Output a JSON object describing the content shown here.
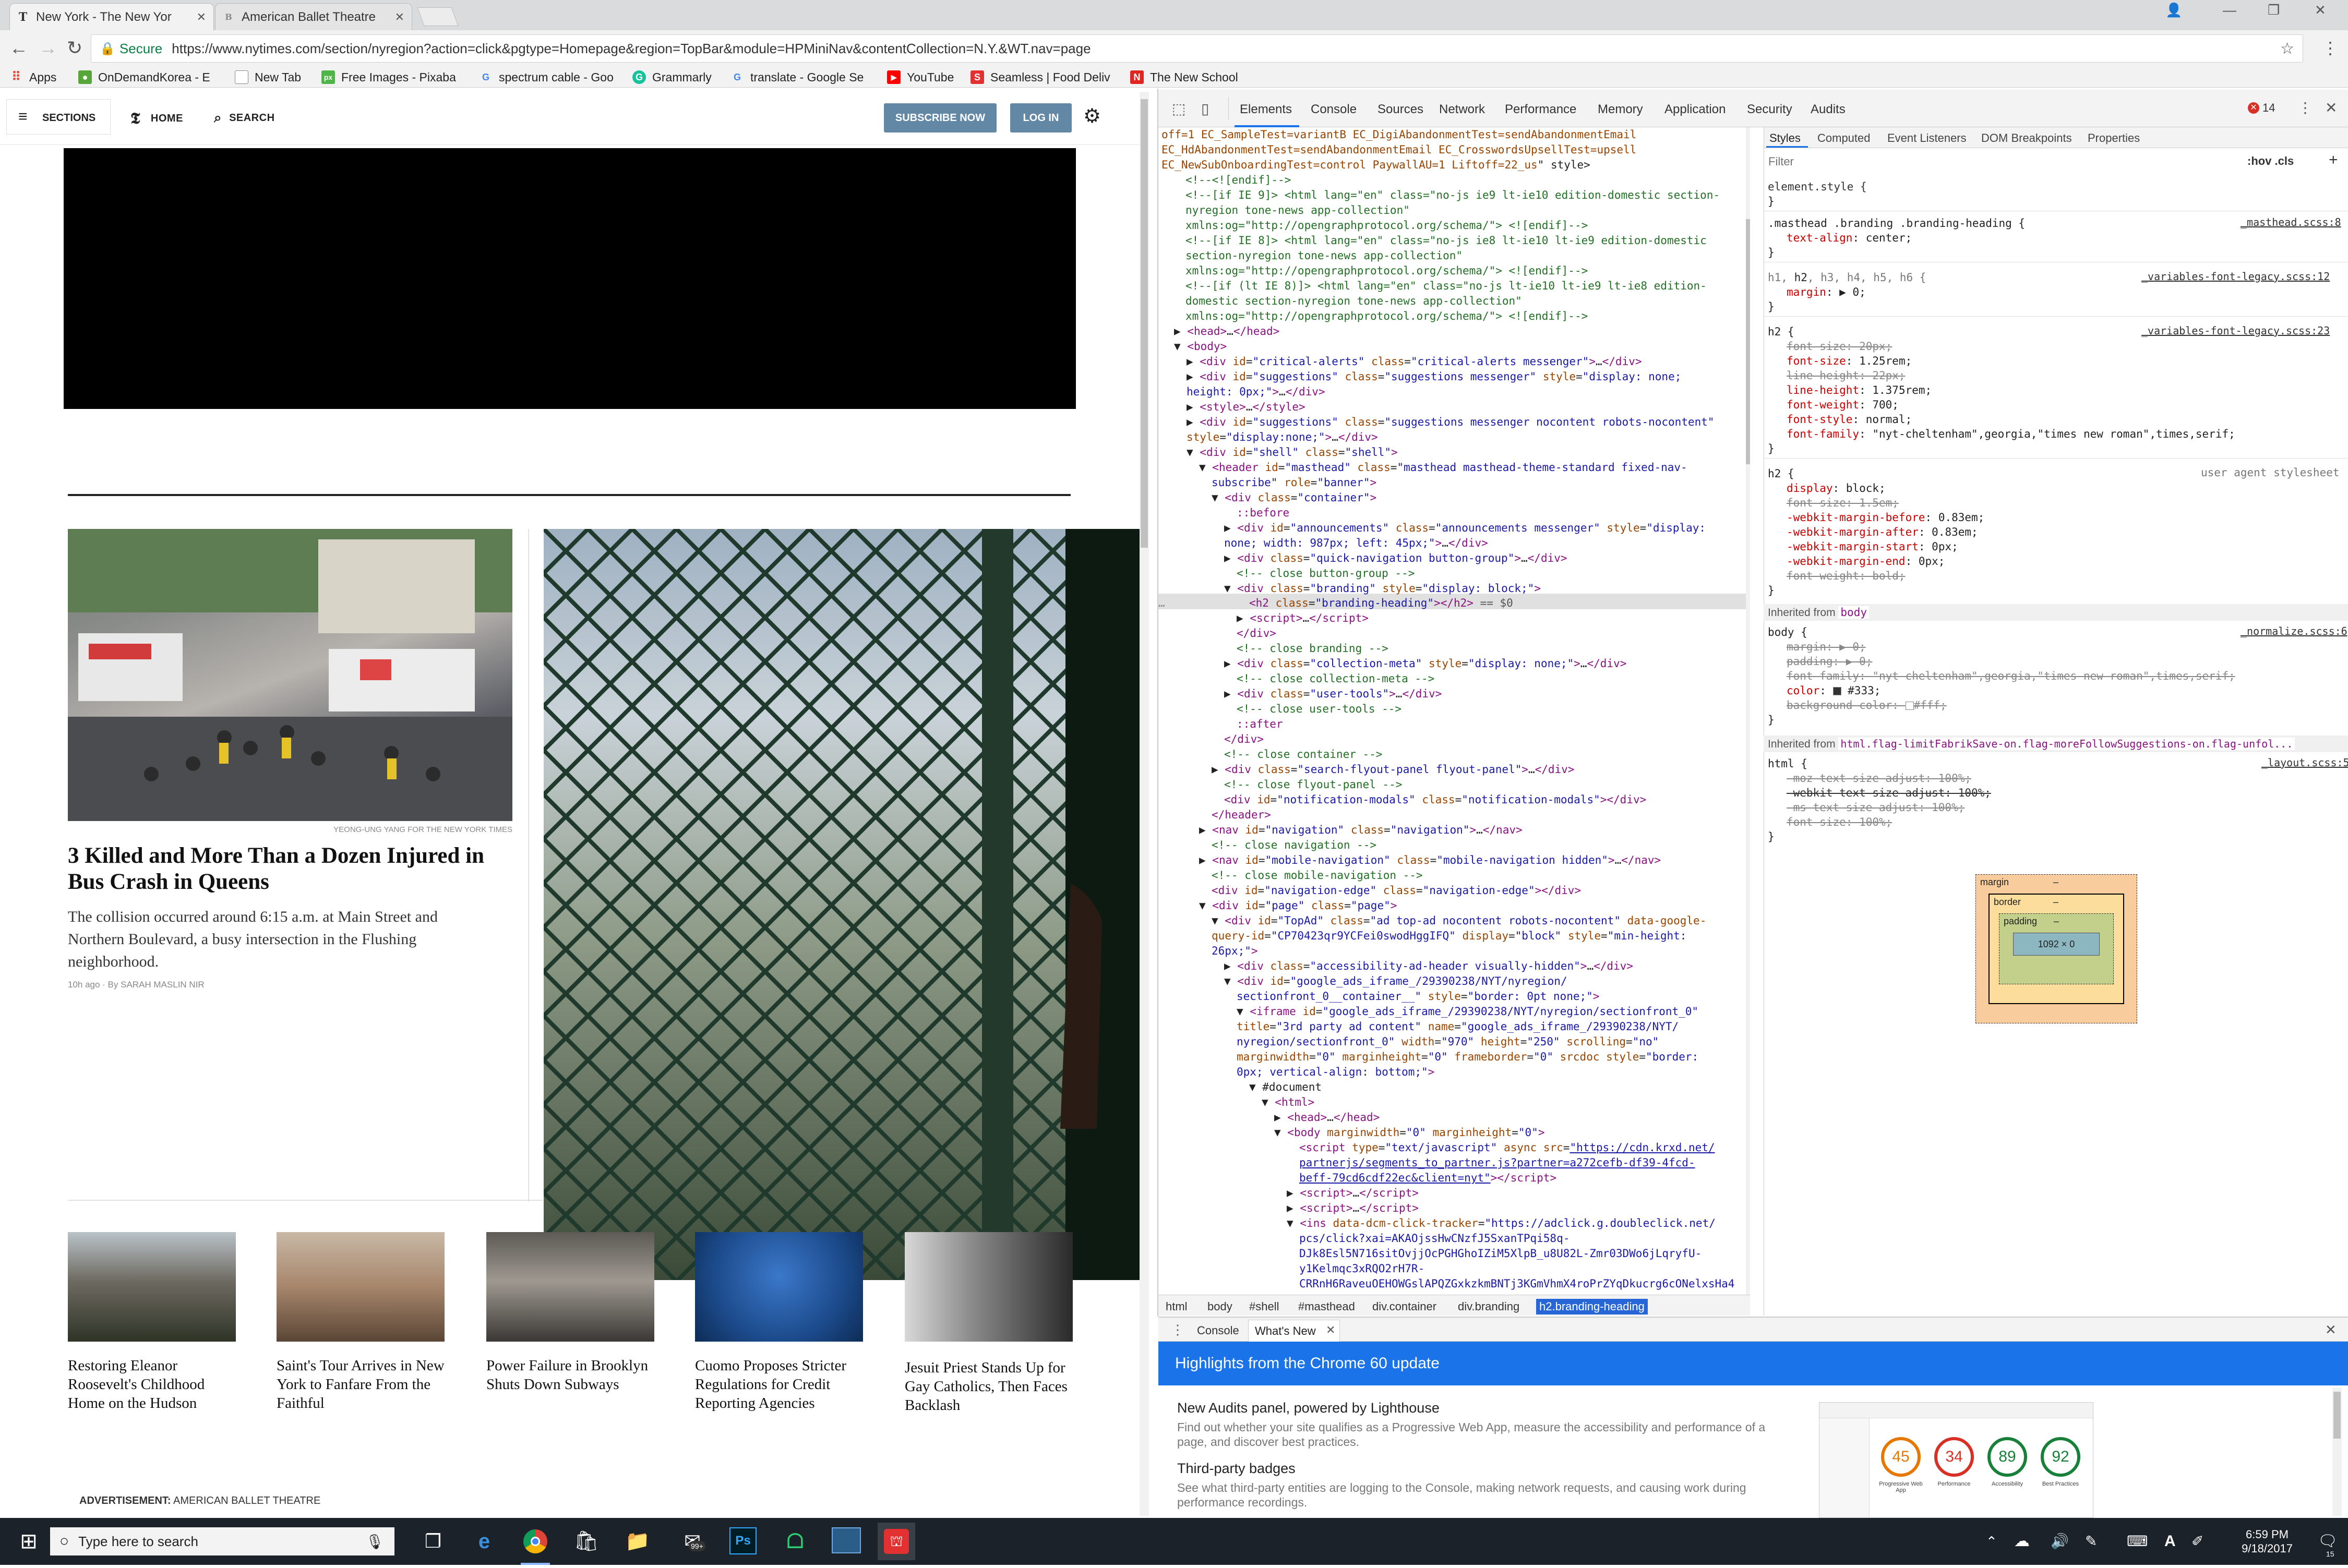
{
  "browser": {
    "tabs": [
      {
        "title": "New York - The New Yor",
        "favicon": "T",
        "active": true
      },
      {
        "title": "American Ballet Theatre",
        "favicon": "B",
        "active": false
      }
    ],
    "secure_label": "Secure",
    "url": "https://www.nytimes.com/section/nyregion?action=click&pgtype=Homepage&region=TopBar&module=HPMiniNav&contentCollection=N.Y.&WT.nav=page",
    "bookmarks": [
      {
        "label": "Apps",
        "icon": "apps-grid-icon",
        "color": "#e04b3c"
      },
      {
        "label": "OnDemandKorea - E",
        "icon": "odk-icon",
        "color": "#57a639"
      },
      {
        "label": "New Tab",
        "icon": "page-icon",
        "color": "#ffffff"
      },
      {
        "label": "Free Images - Pixaba",
        "icon": "pixabay-icon",
        "color": "#4fb548"
      },
      {
        "label": "spectrum cable - Goo",
        "icon": "google-icon",
        "color": "#ffffff"
      },
      {
        "label": "Grammarly",
        "icon": "grammarly-icon",
        "color": "#15c39a"
      },
      {
        "label": "translate - Google Se",
        "icon": "google-icon",
        "color": "#ffffff"
      },
      {
        "label": "YouTube",
        "icon": "youtube-icon",
        "color": "#ff0000"
      },
      {
        "label": "Seamless | Food Deliv",
        "icon": "seamless-icon",
        "color": "#e33131"
      },
      {
        "label": "The New School",
        "icon": "newschool-icon",
        "color": "#e0261f"
      }
    ]
  },
  "nyt": {
    "sections_label": "SECTIONS",
    "home_label": "HOME",
    "search_label": "SEARCH",
    "subscribe_label": "SUBSCRIBE NOW",
    "login_label": "LOG IN",
    "lead_story": {
      "caption": "YEONG-UNG YANG FOR THE NEW YORK TIMES",
      "headline": "3 Killed and More Than a Dozen Injured in Bus Crash in Queens",
      "summary": "The collision occurred around 6:15 a.m. at Main Street and Northern Boulevard, a busy intersection in the Flushing neighborhood.",
      "byline": "10h ago  ·  By SARAH MASLIN NIR"
    },
    "small_stories": [
      {
        "headline": "Restoring Eleanor Roosevelt's Childhood Home on the Hudson"
      },
      {
        "headline": "Saint's Tour Arrives in New York to Fanfare From the Faithful"
      },
      {
        "headline": "Power Failure in Brooklyn Shuts Down Subways"
      },
      {
        "headline": "Cuomo Proposes Stricter Regulations for Credit Reporting Agencies"
      },
      {
        "headline": "Jesuit Priest Stands Up for Gay Catholics, Then Faces Backlash"
      }
    ],
    "advertisement_prefix": "ADVERTISEMENT:",
    "advertisement_name": "AMERICAN BALLET THEATRE"
  },
  "devtools": {
    "tabs": [
      "Elements",
      "Console",
      "Sources",
      "Network",
      "Performance",
      "Memory",
      "Application",
      "Security",
      "Audits"
    ],
    "error_count": "14",
    "style_tabs": [
      "Styles",
      "Computed",
      "Event Listeners",
      "DOM Breakpoints",
      "Properties"
    ],
    "filter_placeholder": "Filter",
    "hov_cls": ":hov  .cls",
    "breadcrumbs": [
      "html",
      "body",
      "#shell",
      "#masthead",
      "div.container",
      "div.branding",
      "h2.branding-heading"
    ],
    "inherited_body": "Inherited from",
    "inherited_body_tag": "body",
    "inherited_html_tag": "html.flag-limitFabrikSave-on.flag-moreFollowSuggestions-on.flag-unfol...",
    "box_model": {
      "margin": "margin",
      "border": "border",
      "padding": "padding",
      "content": "1092 × 0",
      "dash": "–"
    },
    "drawer_tabs": [
      "Console",
      "What's New"
    ],
    "whats_new_title": "Highlights from the Chrome 60 update",
    "news": [
      {
        "title": "New Audits panel, powered by Lighthouse",
        "body": "Find out whether your site qualifies as a Progressive Web App, measure the accessibility and performance of a page, and discover best practices."
      },
      {
        "title": "Third-party badges",
        "body": "See what third-party entities are logging to the Console, making network requests, and causing work during performance recordings."
      }
    ],
    "lighthouse_scores": [
      {
        "value": "45",
        "label": "Progressive Web App",
        "color": "#e67700"
      },
      {
        "value": "34",
        "label": "Performance",
        "color": "#d93025"
      },
      {
        "value": "89",
        "label": "Accessibility",
        "color": "#188038"
      },
      {
        "value": "92",
        "label": "Best Practices",
        "color": "#188038"
      }
    ]
  },
  "taskbar": {
    "search_placeholder": "Type here to search",
    "time": "6:59 PM",
    "date": "9/18/2017",
    "notification_count": "15",
    "badge": "99+"
  }
}
